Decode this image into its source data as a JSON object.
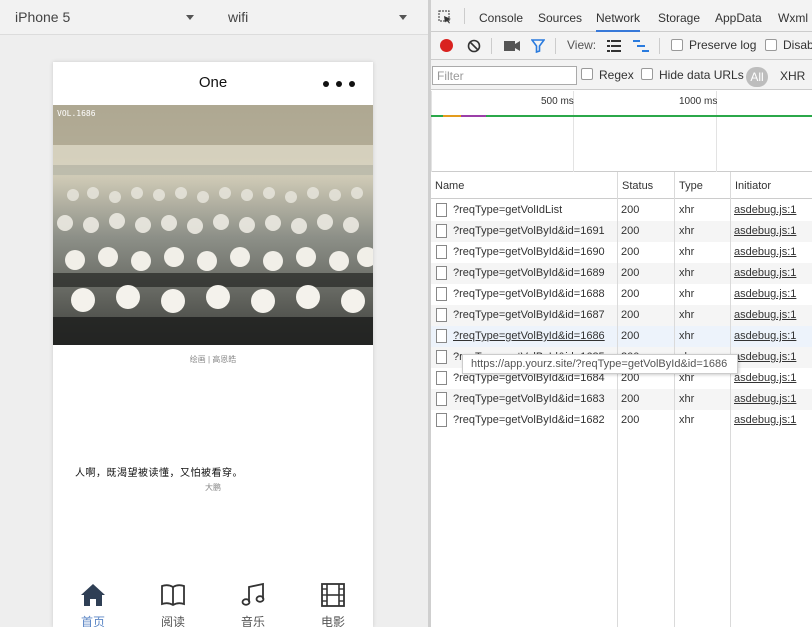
{
  "simulator": {
    "device": "iPhone 5",
    "network": "wifi"
  },
  "app": {
    "nav_title": "One",
    "vol_label": "VOL.1686",
    "photo_caption": "绘画 | 高恩皓",
    "quote": "人啊，既渴望被读懂，又怕被看穿。",
    "author": "大鹏",
    "tabs": [
      {
        "label": "首页",
        "icon": "home-icon",
        "active": true
      },
      {
        "label": "阅读",
        "icon": "book-icon",
        "active": false
      },
      {
        "label": "音乐",
        "icon": "music-note-icon",
        "active": false
      },
      {
        "label": "电影",
        "icon": "film-icon",
        "active": false
      }
    ],
    "accent_color": "#5b86c5"
  },
  "devtools": {
    "tabs": [
      "Console",
      "Sources",
      "Network",
      "Storage",
      "AppData",
      "Wxml"
    ],
    "active_tab": "Network",
    "toolbar": {
      "view_label": "View:",
      "preserve_log": "Preserve log",
      "disable_cache": "Disab"
    },
    "filter": {
      "placeholder": "Filter",
      "regex": "Regex",
      "hide_data_urls": "Hide data URLs",
      "all": "All",
      "xhr": "XHR"
    },
    "timeline": {
      "ticks": [
        "500 ms",
        "1000 ms"
      ]
    },
    "columns": [
      "Name",
      "Status",
      "Type",
      "Initiator"
    ],
    "requests": [
      {
        "name": "?reqType=getVolIdList",
        "status": "200",
        "type": "xhr",
        "initiator": "asdebug.js:1"
      },
      {
        "name": "?reqType=getVolById&id=1691",
        "status": "200",
        "type": "xhr",
        "initiator": "asdebug.js:1"
      },
      {
        "name": "?reqType=getVolById&id=1690",
        "status": "200",
        "type": "xhr",
        "initiator": "asdebug.js:1"
      },
      {
        "name": "?reqType=getVolById&id=1689",
        "status": "200",
        "type": "xhr",
        "initiator": "asdebug.js:1"
      },
      {
        "name": "?reqType=getVolById&id=1688",
        "status": "200",
        "type": "xhr",
        "initiator": "asdebug.js:1"
      },
      {
        "name": "?reqType=getVolById&id=1687",
        "status": "200",
        "type": "xhr",
        "initiator": "asdebug.js:1"
      },
      {
        "name": "?reqType=getVolById&id=1686",
        "status": "200",
        "type": "xhr",
        "initiator": "asdebug.js:1"
      },
      {
        "name": "?reqType=getVolById&id=1685",
        "status": "200",
        "type": "xhr",
        "initiator": "asdebug.js:1"
      },
      {
        "name": "?reqType=getVolById&id=1684",
        "status": "200",
        "type": "xhr",
        "initiator": "asdebug.js:1"
      },
      {
        "name": "?reqType=getVolById&id=1683",
        "status": "200",
        "type": "xhr",
        "initiator": "asdebug.js:1"
      },
      {
        "name": "?reqType=getVolById&id=1682",
        "status": "200",
        "type": "xhr",
        "initiator": "asdebug.js:1"
      }
    ],
    "tooltip": "https://app.yourz.site/?reqType=getVolById&id=1686",
    "record_color": "#d9221f"
  }
}
